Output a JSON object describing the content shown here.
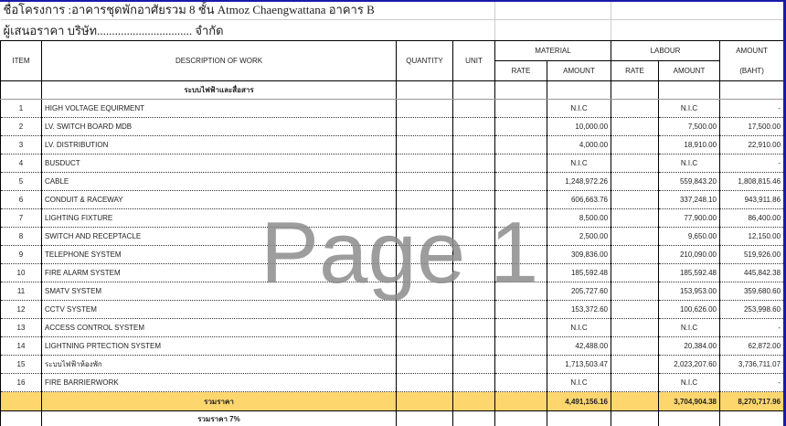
{
  "header": {
    "project": "ชื่อโครงการ :อาคารชุดพักอาศัยรวม 8 ชั้น  Atmoz Chaengwattana อาคาร B",
    "bidder": "ผู้เสนอราคา  บริษัท................................ จำกัด"
  },
  "columns": {
    "item": "ITEM",
    "description": "DESCRIPTION  OF  WORK",
    "quantity": "QUANTITY",
    "unit": "UNIT",
    "material": "MATERIAL",
    "labour": "LABOUR",
    "amount": "AMOUNT",
    "rate": "RATE",
    "amount_sub": "AMOUNT",
    "baht": "(BAHT)"
  },
  "section": "ระบบไฟฟ้าและสื่อสาร",
  "rows": [
    {
      "item": "1",
      "desc": "HIGH VOLTAGE EQUIRMENT",
      "mat": "N.I.C",
      "lab": "N.I.C",
      "total": "-"
    },
    {
      "item": "2",
      "desc": "LV. SWITCH BOARD MDB",
      "mat": "10,000.00",
      "lab": "7,500.00",
      "total": "17,500.00"
    },
    {
      "item": "3",
      "desc": "LV. DISTRIBUTION",
      "mat": "4,000.00",
      "lab": "18,910.00",
      "total": "22,910.00"
    },
    {
      "item": "4",
      "desc": "BUSDUCT",
      "mat": "N.I.C",
      "lab": "N.I.C",
      "total": "-"
    },
    {
      "item": "5",
      "desc": "CABLE",
      "mat": "1,248,972.26",
      "lab": "559,843.20",
      "total": "1,808,815.46"
    },
    {
      "item": "6",
      "desc": "CONDUIT & RACEWAY",
      "mat": "606,663.76",
      "lab": "337,248.10",
      "total": "943,911.86"
    },
    {
      "item": "7",
      "desc": "LIGHTING FIXTURE",
      "mat": "8,500.00",
      "lab": "77,900.00",
      "total": "86,400.00"
    },
    {
      "item": "8",
      "desc": "SWITCH AND RECEPTACLE",
      "mat": "2,500.00",
      "lab": "9,650.00",
      "total": "12,150.00"
    },
    {
      "item": "9",
      "desc": "TELEPHONE SYSTEM",
      "mat": "309,836.00",
      "lab": "210,090.00",
      "total": "519,926.00"
    },
    {
      "item": "10",
      "desc": "FIRE ALARM SYSTEM",
      "mat": "185,592.48",
      "lab": "185,592.48",
      "total": "445,842.38"
    },
    {
      "item": "11",
      "desc": "SMATV SYSTEM",
      "mat": "205,727.60",
      "lab": "153,953.00",
      "total": "359,680.60"
    },
    {
      "item": "12",
      "desc": "CCTV SYSTEM",
      "mat": "153,372.60",
      "lab": "100,626.00",
      "total": "253,998.60"
    },
    {
      "item": "13",
      "desc": "ACCESS CONTROL SYSTEM",
      "mat": "N.I.C",
      "lab": "N.I.C",
      "total": "-"
    },
    {
      "item": "14",
      "desc": "LIGHTNING PRTECTION SYSTEM",
      "mat": "42,488.00",
      "lab": "20,384.00",
      "total": "62,872.00"
    },
    {
      "item": "15",
      "desc": "ระบบไฟฟ้าห้องพัก",
      "mat": "1,713,503.47",
      "lab": "2,023,207.60",
      "total": "3,736,711.07"
    },
    {
      "item": "16",
      "desc": "FIRE BARRIERWORK",
      "mat": "N.I.C",
      "lab": "N.I.C",
      "total": "-"
    }
  ],
  "total": {
    "label": "รวมราคา",
    "mat": "4,491,156.16",
    "lab": "3,704,904.38",
    "total": "8,270,717.96"
  },
  "vat_label": "รวมราคา 7%",
  "watermark": "Page 1"
}
